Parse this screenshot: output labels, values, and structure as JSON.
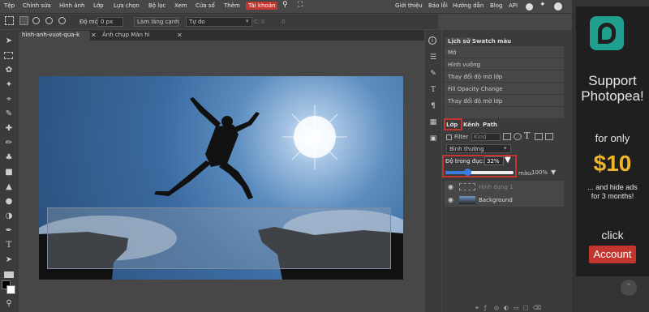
{
  "menu": {
    "items": [
      "Tệp",
      "Chỉnh sửa",
      "Hình ảnh",
      "Lớp",
      "Lựa chọn",
      "Bộ lọc",
      "Xem",
      "Cửa sổ",
      "Thêm"
    ],
    "active": "Tài khoản",
    "right": [
      "Giới thiệu",
      "Báo lỗi",
      "Hướng dẫn",
      "Blog",
      "API"
    ]
  },
  "options": {
    "blur_label": "Độ mờ:",
    "blur_value": "0 px",
    "antialias_label": "Làm láng cạnh",
    "style_value": "Tự do",
    "w_label": "C:",
    "w_value": "0",
    "h_value": "0"
  },
  "tabs": [
    {
      "label": "hình-anh-vuot-qua-k"
    },
    {
      "label": "Ảnh chụp Màn hì"
    }
  ],
  "history": {
    "tab_active": "Lịch sử",
    "tab_other": "Swatch màu",
    "items": [
      "Mở",
      "Hình vuông",
      "Thay đổi độ mờ lớp",
      "Fill Opacity Change",
      "Thay đổi độ mờ lớp"
    ]
  },
  "layers": {
    "tab_active": "Lớp",
    "tabs": [
      "Kênh",
      "Path"
    ],
    "filter_label": "Filter",
    "filter_value": "Kind",
    "blend_mode": "Bình thường",
    "opacity_label": "Độ trong đục:",
    "opacity_value": "32%",
    "opacity_fraction": 0.32,
    "fill_label": "màu:",
    "fill_value": "100%",
    "items": [
      {
        "name": "Hình dạng 1"
      },
      {
        "name": "Background"
      }
    ]
  },
  "ad": {
    "line1": "Support",
    "line2": "Photopea!",
    "for_only": "for only",
    "price": "$10",
    "sub1": "... and hide ads",
    "sub2": "for 3 months!",
    "click": "click",
    "button": "Account"
  },
  "colors": {
    "accent": "#c3352f",
    "slider": "#3a7be0"
  }
}
